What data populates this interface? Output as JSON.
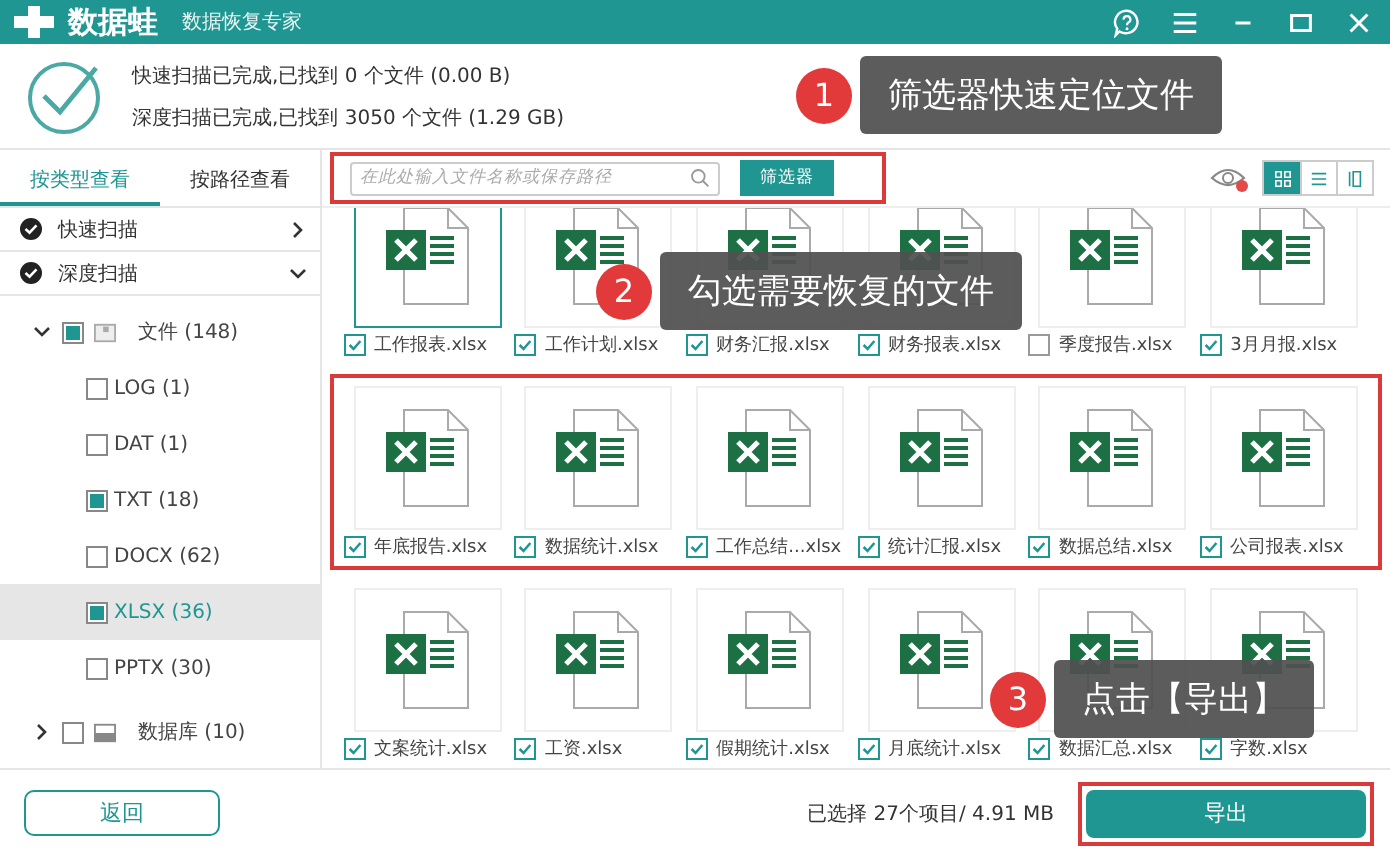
{
  "window": {
    "title": "数据蛙",
    "subtitle": "数据恢复专家"
  },
  "scan_status": [
    "快速扫描已完成,已找到 0 个文件 (0.00  B)",
    "深度扫描已完成,已找到 3050 个文件 (1.29 GB)"
  ],
  "sidebar": {
    "tabs": [
      {
        "label": "按类型查看",
        "selected": true
      },
      {
        "label": "按路径查看",
        "selected": false
      }
    ],
    "sections": [
      {
        "label": "快速扫描",
        "expanded": false
      },
      {
        "label": "深度扫描",
        "expanded": true,
        "children": [
          {
            "label": "文件 (148)",
            "kind": "folder",
            "expanded": true,
            "checked": true,
            "children": [
              {
                "label": "LOG (1)",
                "checked": false,
                "selected": false
              },
              {
                "label": "DAT (1)",
                "checked": false,
                "selected": false
              },
              {
                "label": "TXT (18)",
                "checked": true,
                "selected": false
              },
              {
                "label": "DOCX (62)",
                "checked": false,
                "selected": false
              },
              {
                "label": "XLSX (36)",
                "checked": true,
                "selected": true
              },
              {
                "label": "PPTX (30)",
                "checked": false,
                "selected": false
              }
            ]
          },
          {
            "label": "数据库 (10)",
            "kind": "database",
            "expanded": false,
            "checked": false
          }
        ]
      }
    ]
  },
  "toolbar": {
    "search_placeholder": "在此处输入文件名称或保存路径",
    "filter_button": "筛选器",
    "preview_hidden": true,
    "views": [
      {
        "kind": "grid",
        "selected": true
      },
      {
        "kind": "list",
        "selected": false
      },
      {
        "kind": "detail",
        "selected": false
      }
    ]
  },
  "file_rows": [
    {
      "highlighted": false,
      "files": [
        {
          "name": "工作报表.xlsx",
          "checked": true,
          "selected": true
        },
        {
          "name": "工作计划.xlsx",
          "checked": true,
          "selected": false
        },
        {
          "name": "财务汇报.xlsx",
          "checked": true,
          "selected": false
        },
        {
          "name": "财务报表.xlsx",
          "checked": true,
          "selected": false
        },
        {
          "name": "季度报告.xlsx",
          "checked": false,
          "selected": false
        },
        {
          "name": "3月月报.xlsx",
          "checked": true,
          "selected": false
        }
      ]
    },
    {
      "highlighted": true,
      "files": [
        {
          "name": "年底报告.xlsx",
          "checked": true,
          "selected": false
        },
        {
          "name": "数据统计.xlsx",
          "checked": true,
          "selected": false
        },
        {
          "name": "工作总结...xlsx",
          "checked": true,
          "selected": false
        },
        {
          "name": "统计汇报.xlsx",
          "checked": true,
          "selected": false
        },
        {
          "name": "数据总结.xlsx",
          "checked": true,
          "selected": false
        },
        {
          "name": "公司报表.xlsx",
          "checked": true,
          "selected": false
        }
      ]
    },
    {
      "highlighted": false,
      "files": [
        {
          "name": "文案统计.xlsx",
          "checked": true,
          "selected": false
        },
        {
          "name": "工资.xlsx",
          "checked": true,
          "selected": false
        },
        {
          "name": "假期统计.xlsx",
          "checked": true,
          "selected": false
        },
        {
          "name": "月底统计.xlsx",
          "checked": true,
          "selected": false
        },
        {
          "name": "数据汇总.xlsx",
          "checked": true,
          "selected": false
        },
        {
          "name": "字数.xlsx",
          "checked": true,
          "selected": false
        }
      ]
    }
  ],
  "footer": {
    "back_button": "返回",
    "selection": "已选择 27个项目/ 4.91 MB",
    "export_button": "导出",
    "export_highlighted": true
  },
  "callouts": [
    {
      "number": "1",
      "text": "筛选器快速定位文件"
    },
    {
      "number": "2",
      "text": "勾选需要恢复的文件"
    },
    {
      "number": "3",
      "text": "点击【导出】"
    }
  ]
}
